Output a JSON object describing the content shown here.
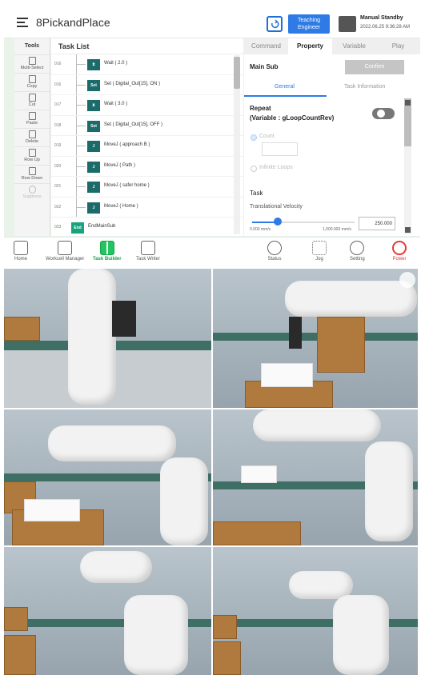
{
  "header": {
    "title": "8PickandPlace",
    "teaching_button": "Teaching Engineer",
    "status_title": "Manual Standby",
    "status_datetime": "2022.06.25 9:36:28 AM"
  },
  "tools": {
    "title": "Tools",
    "items": [
      {
        "label": "Multi-Select"
      },
      {
        "label": "Copy"
      },
      {
        "label": "Cut"
      },
      {
        "label": "Paste"
      },
      {
        "label": "Delete"
      },
      {
        "label": "Row Up"
      },
      {
        "label": "Row Down"
      },
      {
        "label": "Suppress"
      }
    ]
  },
  "task_list": {
    "title": "Task List",
    "rows": [
      {
        "num": "016",
        "icon": "wait-icon",
        "text": "Wait  ( 2.0 )"
      },
      {
        "num": "016",
        "icon": "set-icon",
        "icon_text": "Set",
        "text": "Set  ( Digital_Out[15], ON )"
      },
      {
        "num": "017",
        "icon": "wait-icon",
        "text": "Wait  ( 3.0 )"
      },
      {
        "num": "018",
        "icon": "set-icon",
        "icon_text": "Set",
        "text": "Set  ( Digital_Out[15], OFF )"
      },
      {
        "num": "019",
        "icon": "movej-icon",
        "icon_text": "J",
        "text": "MoveJ  ( approach B )"
      },
      {
        "num": "020",
        "icon": "movej-icon",
        "icon_text": "J",
        "text": "MoveJ  ( Path )"
      },
      {
        "num": "021",
        "icon": "movej-icon",
        "icon_text": "J",
        "text": "MoveJ  ( safer home )"
      },
      {
        "num": "022",
        "icon": "movej-icon",
        "icon_text": "J",
        "text": "MoveJ  ( Home )"
      },
      {
        "num": "023",
        "icon": "end-icon",
        "icon_text": "End",
        "text": "EndMainSub"
      }
    ]
  },
  "right_panel": {
    "tabs": [
      "Command",
      "Property",
      "Variable",
      "Play"
    ],
    "active_tab": "Property",
    "main_sub": "Main Sub",
    "confirm": "Confirm",
    "subtabs": [
      "General",
      "Task Information"
    ],
    "repeat_label": "Repeat",
    "repeat_variable": "(Variable : gLoopCountRev)",
    "count_label": "Count",
    "infinite_label": "Infinite Loops",
    "task_label": "Task",
    "velocity_label": "Translational Velocity",
    "velocity_min": "0.000 mm/s",
    "velocity_max": "1,000.000 mm/s",
    "velocity_value": "250.000",
    "velocity_fraction": 0.25
  },
  "nav": {
    "items": [
      {
        "label": "Home",
        "icon": "home-icon"
      },
      {
        "label": "Workcell Manager",
        "icon": "workcell-icon"
      },
      {
        "label": "Task Builder",
        "icon": "task-builder-icon"
      },
      {
        "label": "Task Writer",
        "icon": "task-writer-icon"
      },
      {
        "label": "Status",
        "icon": "status-icon"
      },
      {
        "label": "Jog",
        "icon": "jog-icon"
      },
      {
        "label": "Setting",
        "icon": "setting-icon"
      },
      {
        "label": "Power",
        "icon": "power-icon"
      }
    ],
    "active": "Task Builder"
  },
  "colors": {
    "accent": "#2e7be6",
    "active_nav": "#16a34a",
    "power": "#e53935",
    "tool_bg": "#eaf3ea"
  }
}
